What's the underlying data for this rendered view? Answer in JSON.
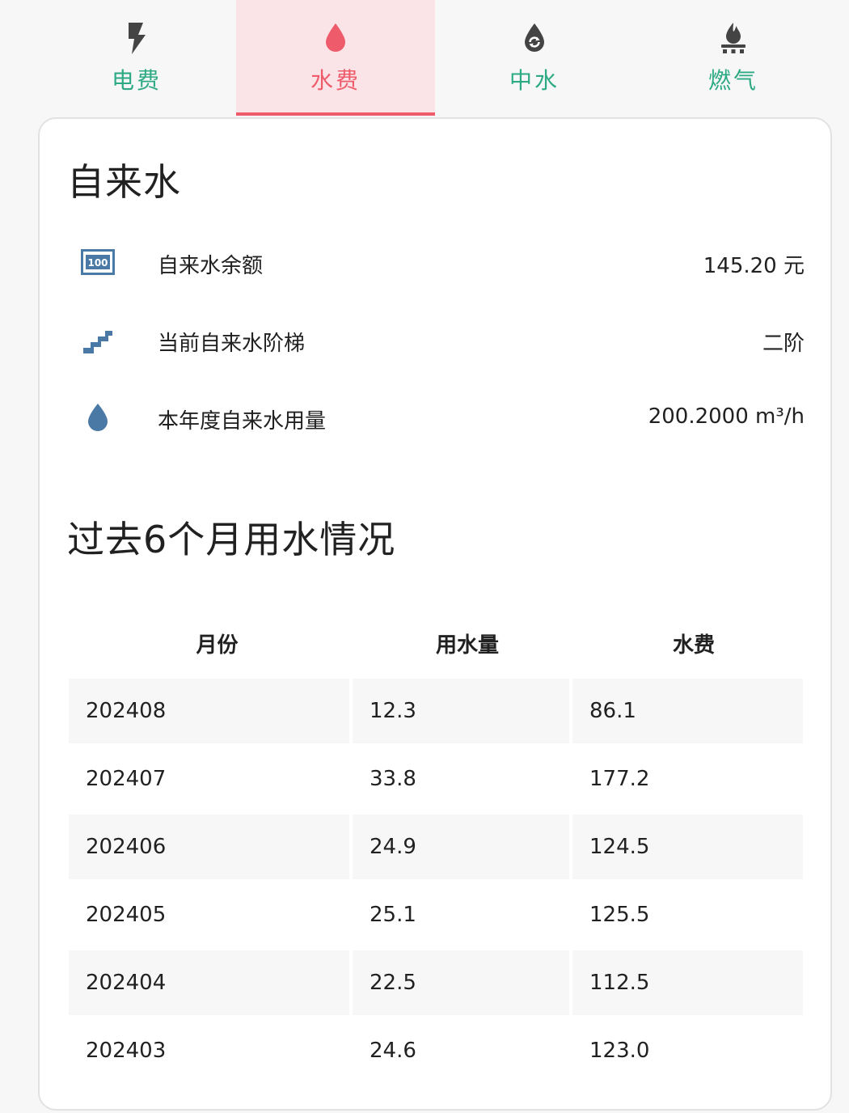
{
  "tabs": [
    {
      "label": "电费",
      "icon": "lightning-bolt-icon",
      "active": false
    },
    {
      "label": "水费",
      "icon": "water-drop-icon",
      "active": true
    },
    {
      "label": "中水",
      "icon": "recycled-water-icon",
      "active": false
    },
    {
      "label": "燃气",
      "icon": "gas-stove-icon",
      "active": false
    }
  ],
  "colors": {
    "accent_active": "#ee5b6b",
    "active_tab_bg": "#fbe4e7",
    "tab_text": "#2daa84",
    "icon_blue": "#4a79a5",
    "icon_dark": "#444444"
  },
  "card": {
    "title": "自来水",
    "rows": [
      {
        "icon": "cash-100-icon",
        "label": "自来水余额",
        "value": "145.20 元"
      },
      {
        "icon": "stairs-icon",
        "label": "当前自来水阶梯",
        "value": "二阶"
      },
      {
        "icon": "water-drop-icon",
        "label": "本年度自来水用量",
        "value": "200.2000 m³/h"
      }
    ],
    "history_title": "过去6个月用水情况"
  },
  "table": {
    "headers": [
      "月份",
      "用水量",
      "水费"
    ],
    "rows": [
      [
        "202408",
        "12.3",
        "86.1"
      ],
      [
        "202407",
        "33.8",
        "177.2"
      ],
      [
        "202406",
        "24.9",
        "124.5"
      ],
      [
        "202405",
        "25.1",
        "125.5"
      ],
      [
        "202404",
        "22.5",
        "112.5"
      ],
      [
        "202403",
        "24.6",
        "123.0"
      ]
    ]
  }
}
